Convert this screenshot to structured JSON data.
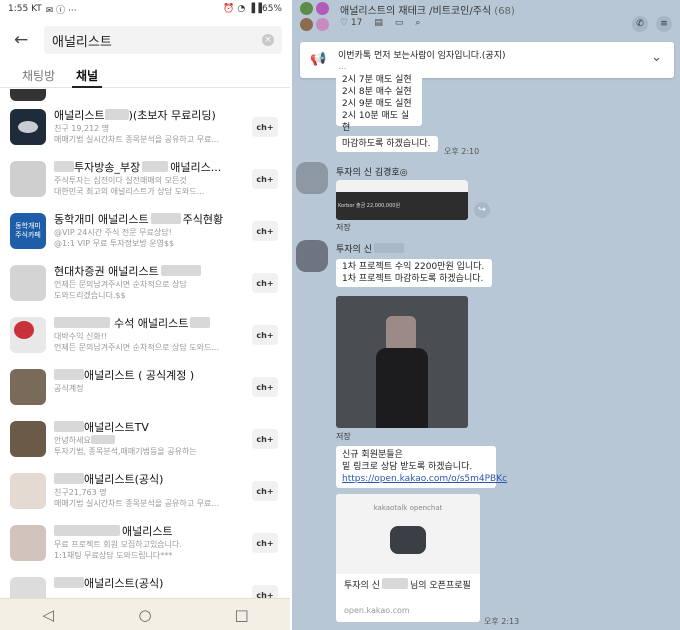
{
  "status_bar": {
    "time": "1:55 KT",
    "icons": "✉ ⓘ ···",
    "battery": "65%"
  },
  "search": {
    "query": "애널리스트",
    "back_icon": "←",
    "clear_icon": "×"
  },
  "tabs": [
    "채팅방",
    "채널"
  ],
  "active_tab": 1,
  "channels": [
    {
      "name": "",
      "sub1": "",
      "sub2": ""
    },
    {
      "name_pre": "애널리스트",
      "name_post": ")(초보자 무료리딩)",
      "sub1": "친구 19,212 명",
      "sub2": "매매기법 실시간차트 종목분석을 공유하고 무료...",
      "avatar_color": "#1d2b3a"
    },
    {
      "name_pre": "투자방송_부장",
      "name_post": "애널리스...",
      "sub1": "주식투자는 심전이다 실전매매의 모든것",
      "sub2": "대한민국 최고의 애널리스트가 상담 도와드...",
      "avatar_color": "#cfcfcf"
    },
    {
      "name_pre": "동학개미 애널리스트",
      "name_post": "주식현황",
      "sub1": "@VIP 24시간 주식 전문 무료상담!",
      "sub2": "@1:1 VIP 무료 투자정보방 운영$$",
      "avatar_color": "#1e5ea8",
      "avatar_text": "동학개미\n주식카페"
    },
    {
      "name_pre": "현대차증권 애널리스트",
      "name_post": "",
      "sub1": "언제든 문의남겨주시면 순차적으로 상담",
      "sub2": "도와드리겠습니다.$$",
      "avatar_color": "#d4d4d4"
    },
    {
      "name_pre": "",
      "name_post": "수석 애널리스트",
      "sub1": "대박수익 신화!!",
      "sub2": "언제든 문의남겨주시면 순차적으로 상담 도와드...",
      "avatar_color": "#c9323a"
    },
    {
      "name_pre": "",
      "name_post": "애널리스트 ( 공식계정 )",
      "sub1": "공식계정",
      "sub2": "",
      "avatar_color": "#7a6a5a"
    },
    {
      "name_pre": "",
      "name_post": "애널리스트TV",
      "sub1": "안녕하세요",
      "sub2": "투자기법, 종목분석,매매기법등을 공유하는",
      "avatar_color": "#6b5a48"
    },
    {
      "name_pre": "",
      "name_post": "애널리스트(공식)",
      "sub1": "친구21,763 명",
      "sub2": "매매기법 실시간차트 종목분석을 공유하고 무료...",
      "avatar_color": "#e4dad2"
    },
    {
      "name_pre": "",
      "name_post": "애널리스트",
      "sub1": "무료 프로젝트 회원 모집하고있습니다.",
      "sub2": "1:1채팅 무료상담 도와드립니다***",
      "avatar_color": "#d2c4bc"
    },
    {
      "name_pre": "",
      "name_post": "애널리스트(공식)",
      "sub1": "",
      "sub2": "",
      "avatar_color": "#dcdcdc"
    }
  ],
  "join_icon": "ch+",
  "nav": [
    "◁",
    "○",
    "□"
  ],
  "room": {
    "title": "애널리스트의 재테크 /비트코인/주식",
    "member_count": "(68)",
    "likes": "♡ 17",
    "notice_text": "이번카톡 먼저 보는사람이 임자입니다.(공지)",
    "notice_sub": "...",
    "notice_icon": "📢",
    "notice_chevron": "⌄"
  },
  "messages": {
    "sched_lines": [
      "2시 7분 매도 실현",
      "2시 8분 매수 실현",
      "2시 9분 매도 실현",
      "2시 10분 매도 실현"
    ],
    "closing": "마감하도록 하겠습니다.",
    "time_210": "오후 2:10",
    "sender1": "투자의 신 김경호",
    "sender1_suffix": "◎",
    "chart_caption": "Korbor 출금 22,000,000원",
    "save1": "저장",
    "sender2": "투자의 신",
    "profit_lines": [
      "1차 프로젝트 수익 2200만원 입니다.",
      "1차 프로젝트 마감하도록 하겠습니다."
    ],
    "save2": "저장",
    "new_member_lines": [
      "신규 회원분들은",
      "밑 링크로 상담 받도록 하겠습니다."
    ],
    "link": "https://open.kakao.com/o/s5m4PBKc",
    "og_brand": "kakaotalk openchat",
    "og_title_pre": "투자의 신",
    "og_title_post": "님의 오픈프로필",
    "og_url": "open.kakao.com",
    "time_213": "오후 2:13"
  }
}
